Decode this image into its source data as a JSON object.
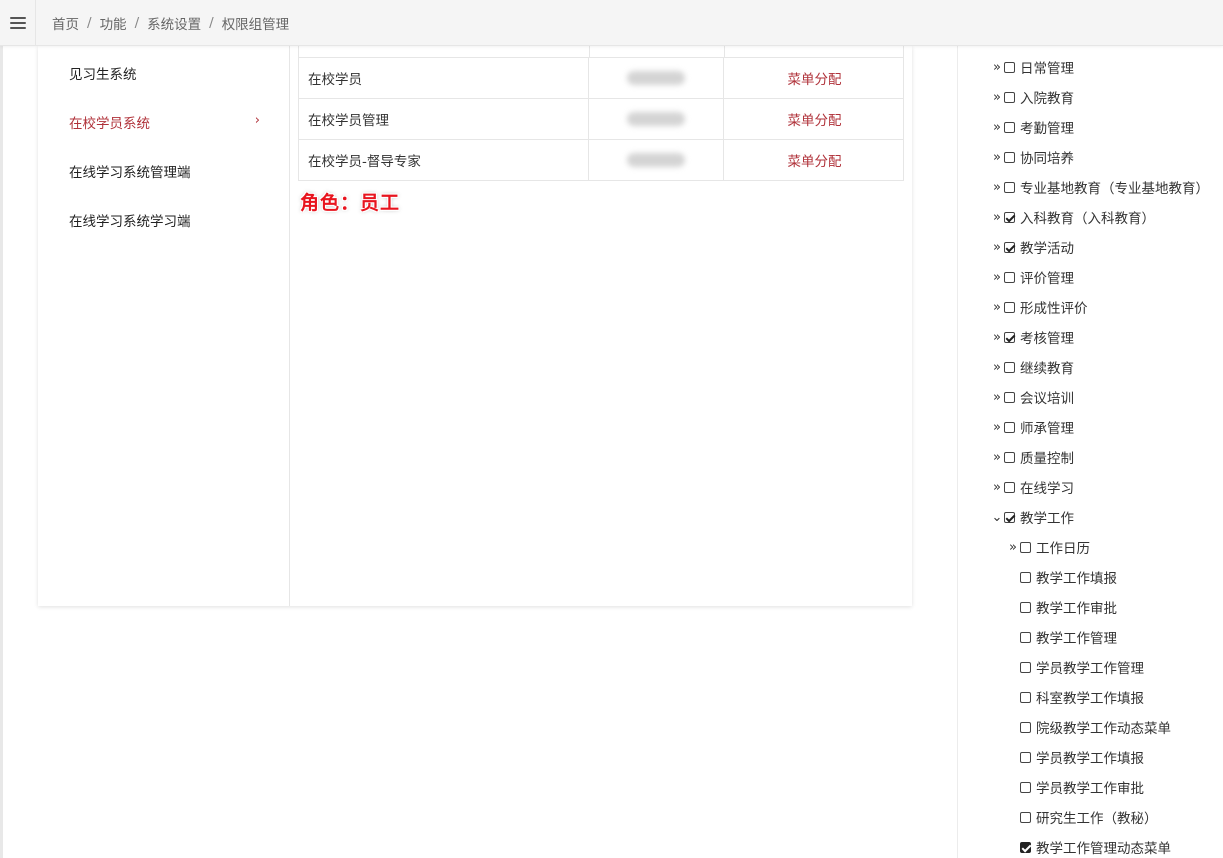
{
  "breadcrumb": {
    "home": "首页",
    "function": "功能",
    "settings": "系统设置",
    "current": "权限组管理",
    "separator": "/"
  },
  "systems": [
    {
      "label": "见习生系统"
    },
    {
      "label": "在校学员系统",
      "active": true,
      "chevron": "›"
    },
    {
      "label": "在线学习系统管理端"
    },
    {
      "label": "在线学习系统学习端"
    }
  ],
  "roles": [
    {
      "name": "在校学员",
      "action": "菜单分配"
    },
    {
      "name": "在校学员管理",
      "action": "菜单分配"
    },
    {
      "name": "在校学员-督导专家",
      "action": "菜单分配"
    }
  ],
  "annotation": "角色：员工",
  "menu_tree": [
    {
      "label": "日常管理",
      "expand": "»",
      "checked": false
    },
    {
      "label": "入院教育",
      "expand": "»",
      "checked": false
    },
    {
      "label": "考勤管理",
      "expand": "»",
      "checked": false
    },
    {
      "label": "协同培养",
      "expand": "»",
      "checked": false
    },
    {
      "label": "专业基地教育（专业基地教育）",
      "expand": "»",
      "checked": false
    },
    {
      "label": "入科教育（入科教育）",
      "expand": "»",
      "checked": true
    },
    {
      "label": "教学活动",
      "expand": "»",
      "checked": true
    },
    {
      "label": "评价管理",
      "expand": "»",
      "checked": false
    },
    {
      "label": "形成性评价",
      "expand": "»",
      "checked": false
    },
    {
      "label": "考核管理",
      "expand": "»",
      "checked": true
    },
    {
      "label": "继续教育",
      "expand": "»",
      "checked": false
    },
    {
      "label": "会议培训",
      "expand": "»",
      "checked": false
    },
    {
      "label": "师承管理",
      "expand": "»",
      "checked": false
    },
    {
      "label": "质量控制",
      "expand": "»",
      "checked": false
    },
    {
      "label": "在线学习",
      "expand": "»",
      "checked": false
    },
    {
      "label": "教学工作",
      "expand": "⌄",
      "checked": true
    },
    {
      "label": "工作日历",
      "expand": "»",
      "checked": false,
      "child": true
    },
    {
      "label": "教学工作填报",
      "expand": "",
      "checked": false,
      "child": true
    },
    {
      "label": "教学工作审批",
      "expand": "",
      "checked": false,
      "child": true
    },
    {
      "label": "教学工作管理",
      "expand": "",
      "checked": false,
      "child": true
    },
    {
      "label": "学员教学工作管理",
      "expand": "",
      "checked": false,
      "child": true
    },
    {
      "label": "科室教学工作填报",
      "expand": "",
      "checked": false,
      "child": true
    },
    {
      "label": "院级教学工作动态菜单",
      "expand": "",
      "checked": false,
      "child": true
    },
    {
      "label": "学员教学工作填报",
      "expand": "",
      "checked": false,
      "child": true
    },
    {
      "label": "学员教学工作审批",
      "expand": "",
      "checked": false,
      "child": true
    },
    {
      "label": "研究生工作（教秘）",
      "expand": "",
      "checked": false,
      "child": true
    },
    {
      "label": "教学工作管理动态菜单",
      "expand": "",
      "checked": true,
      "filled": true,
      "child": true
    }
  ],
  "colors": {
    "accent": "#b0323a",
    "annotation": "#e8141e"
  },
  "icons": {
    "menu": "hamburger-menu-icon",
    "expand": "double-chevron-right-icon",
    "collapse": "chevron-down-icon"
  }
}
